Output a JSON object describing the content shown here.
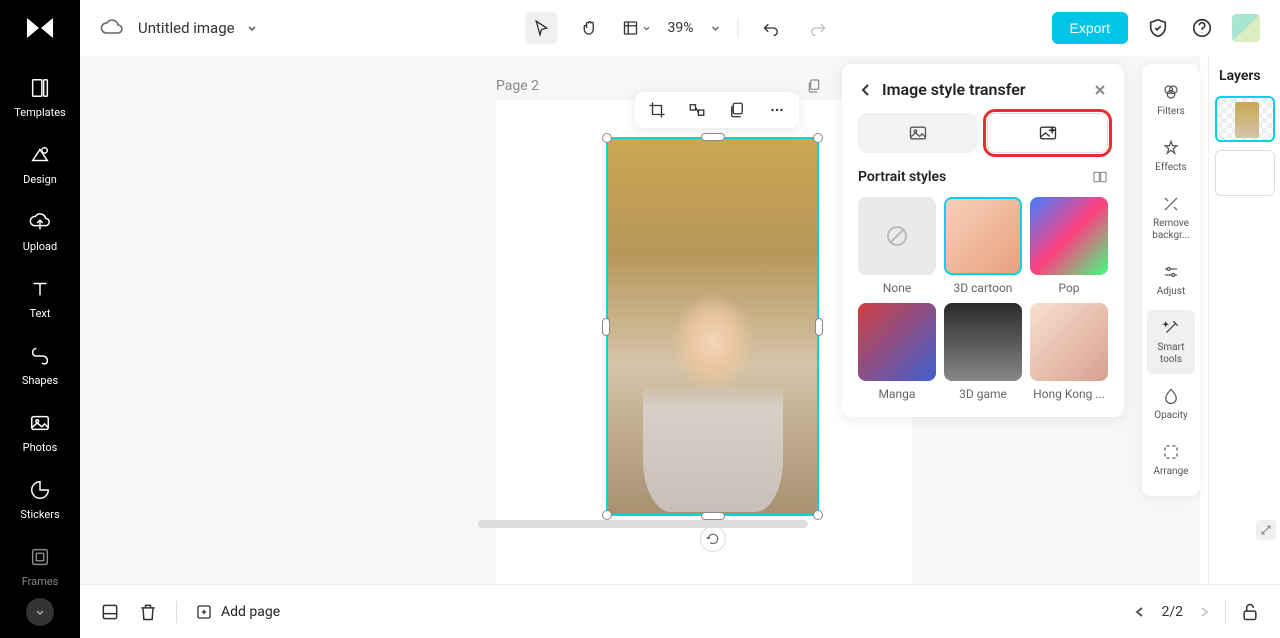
{
  "header": {
    "title": "Untitled image",
    "zoom": "39%",
    "export_label": "Export"
  },
  "sidebar": {
    "items": [
      {
        "label": "Templates"
      },
      {
        "label": "Design"
      },
      {
        "label": "Upload"
      },
      {
        "label": "Text"
      },
      {
        "label": "Shapes"
      },
      {
        "label": "Photos"
      },
      {
        "label": "Stickers"
      },
      {
        "label": "Frames"
      }
    ]
  },
  "canvas": {
    "page_label": "Page 2"
  },
  "style_panel": {
    "title": "Image style transfer",
    "section": "Portrait styles",
    "styles": [
      {
        "label": "None"
      },
      {
        "label": "3D cartoon"
      },
      {
        "label": "Pop"
      },
      {
        "label": "Manga"
      },
      {
        "label": "3D game"
      },
      {
        "label": "Hong Kong ..."
      }
    ]
  },
  "right_panel": {
    "items": [
      {
        "label": "Filters"
      },
      {
        "label": "Effects"
      },
      {
        "label": "Remove backgr..."
      },
      {
        "label": "Adjust"
      },
      {
        "label": "Smart tools"
      },
      {
        "label": "Opacity"
      },
      {
        "label": "Arrange"
      }
    ]
  },
  "layers": {
    "title": "Layers"
  },
  "bottom": {
    "add_page": "Add page",
    "page_indicator": "2/2"
  }
}
